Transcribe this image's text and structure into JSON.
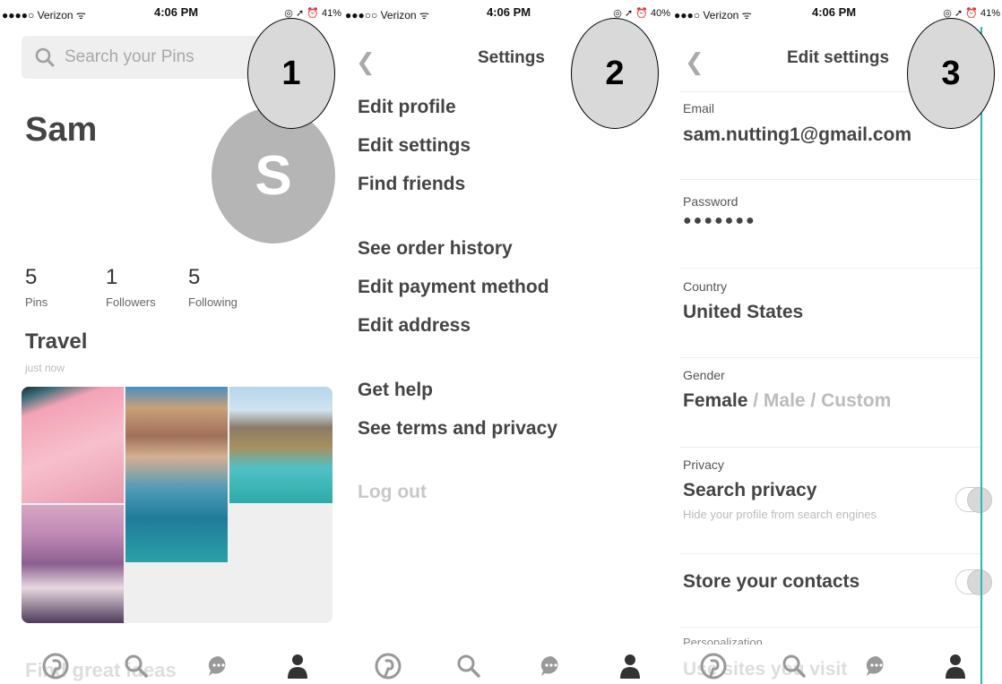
{
  "status": {
    "p1": {
      "carrier": "●●●●○ Verizon ᯤ",
      "time": "4:06 PM",
      "right": "◎ ➚ ⏰ 41%"
    },
    "p2": {
      "carrier": "●●●○○ Verizon ᯤ",
      "time": "4:06 PM",
      "right": "◎ ➚ ⏰ 40%"
    },
    "p3": {
      "carrier": "●●●○ Verizon ᯤ",
      "time": "4:06 PM",
      "right": "◎ ➚ ⏰ 41%"
    }
  },
  "callouts": [
    "1",
    "2",
    "3"
  ],
  "profile": {
    "search_placeholder": "Search your Pins",
    "name": "Sam",
    "avatar_letter": "S",
    "stats": [
      {
        "num": "5",
        "label": "Pins"
      },
      {
        "num": "1",
        "label": "Followers"
      },
      {
        "num": "5",
        "label": "Following"
      }
    ],
    "board_title": "Travel",
    "board_time": "just now",
    "bottom_text": "Find great ideas"
  },
  "settings": {
    "title": "Settings",
    "items": [
      "Edit profile",
      "Edit settings",
      "Find friends",
      "See order history",
      "Edit payment method",
      "Edit address",
      "Get help",
      "See terms and privacy",
      "Log out"
    ]
  },
  "edit_settings": {
    "title": "Edit settings",
    "email_label": "Email",
    "email_value": "sam.nutting1@gmail.com",
    "password_label": "Password",
    "password_value": "●●●●●●●",
    "country_label": "Country",
    "country_value": "United States",
    "gender_label": "Gender",
    "gender_selected": "Female",
    "gender_sep": " / ",
    "gender_other1": "Male",
    "gender_other2": "Custom",
    "privacy_label": "Privacy",
    "search_privacy": "Search privacy",
    "search_privacy_sub": "Hide your profile from search engines",
    "store_contacts": "Store your contacts",
    "personalization_label": "Personalization",
    "bottom_text": "Use sites you visit"
  },
  "colors": {
    "toggle_off": "#d8d8d8",
    "accent_line": "#2bb6b9",
    "callout_fill": "#d9d9d9"
  }
}
